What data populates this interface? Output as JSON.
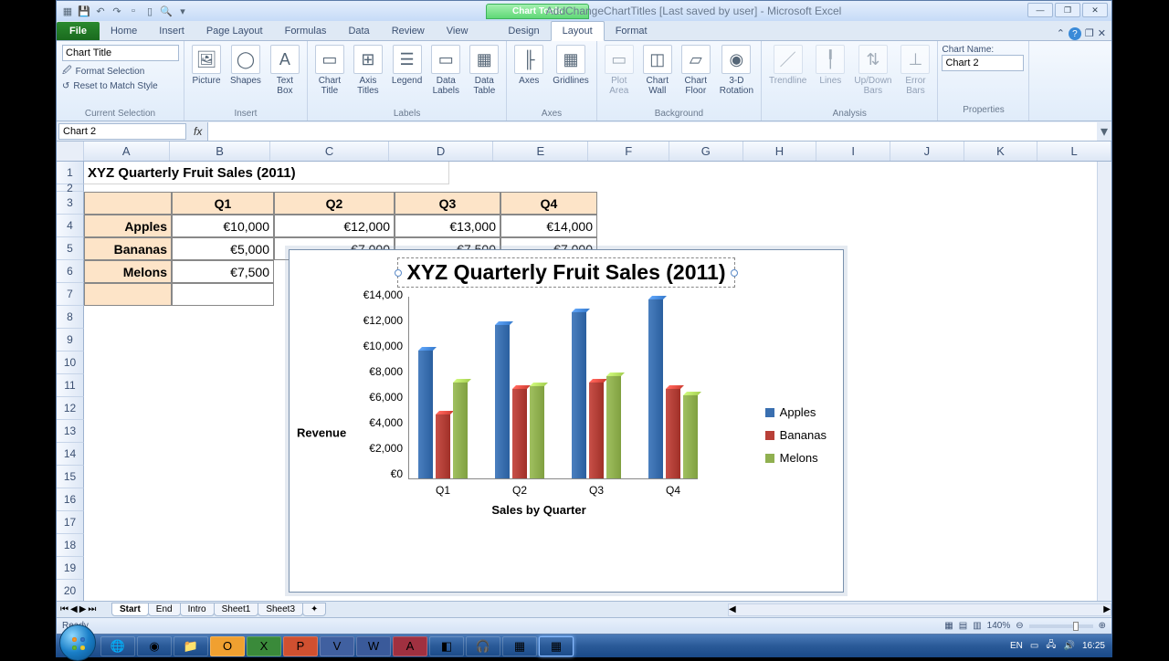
{
  "app": {
    "title": "AddChangeChartTitles [Last saved by user] - Microsoft Excel",
    "chart_tools": "Chart Tools"
  },
  "tabs": {
    "file": "File",
    "items": [
      "Home",
      "Insert",
      "Page Layout",
      "Formulas",
      "Data",
      "Review",
      "View",
      "Design",
      "Layout",
      "Format"
    ],
    "active": "Layout"
  },
  "ribbon": {
    "current_selection": {
      "combo": "Chart Title",
      "format_selection": "Format Selection",
      "reset": "Reset to Match Style",
      "group": "Current Selection"
    },
    "insert": {
      "picture": "Picture",
      "shapes": "Shapes",
      "textbox": "Text\nBox",
      "group": "Insert"
    },
    "labels": {
      "ctitle": "Chart\nTitle",
      "axist": "Axis\nTitles",
      "legend": "Legend",
      "dlabels": "Data\nLabels",
      "dtable": "Data\nTable",
      "group": "Labels"
    },
    "axes": {
      "axes": "Axes",
      "gridlines": "Gridlines",
      "group": "Axes"
    },
    "background": {
      "plotarea": "Plot\nArea",
      "cwall": "Chart\nWall",
      "cfloor": "Chart\nFloor",
      "rot": "3-D\nRotation",
      "group": "Background"
    },
    "analysis": {
      "trend": "Trendline",
      "lines": "Lines",
      "updown": "Up/Down\nBars",
      "error": "Error\nBars",
      "group": "Analysis"
    },
    "properties": {
      "name_label": "Chart Name:",
      "name_value": "Chart 2",
      "group": "Properties"
    }
  },
  "namebox": {
    "value": "Chart 2"
  },
  "sheet": {
    "title": "XYZ Quarterly Fruit Sales (2011)",
    "cols": [
      "A",
      "B",
      "C",
      "D",
      "E",
      "F",
      "G",
      "H",
      "I",
      "J",
      "K",
      "L"
    ],
    "headers": [
      "Q1",
      "Q2",
      "Q3",
      "Q4"
    ],
    "rows": [
      {
        "label": "Apples",
        "vals": [
          "€10,000",
          "€12,000",
          "€13,000",
          "€14,000"
        ]
      },
      {
        "label": "Bananas",
        "vals": [
          "€5,000",
          "€7,000",
          "€7,500",
          "€7,000"
        ]
      },
      {
        "label": "Melons",
        "vals": [
          "€7,500",
          "",
          "",
          ""
        ]
      }
    ]
  },
  "chart_data": {
    "type": "bar",
    "title": "XYZ Quarterly Fruit Sales (2011)",
    "ylabel": "Revenue",
    "xlabel": "Sales by Quarter",
    "categories": [
      "Q1",
      "Q2",
      "Q3",
      "Q4"
    ],
    "series": [
      {
        "name": "Apples",
        "values": [
          10000,
          12000,
          13000,
          14000
        ],
        "color": "#3a6fb0"
      },
      {
        "name": "Bananas",
        "values": [
          5000,
          7000,
          7500,
          7000
        ],
        "color": "#b84038"
      },
      {
        "name": "Melons",
        "values": [
          7500,
          7200,
          8000,
          6500
        ],
        "color": "#90b050"
      }
    ],
    "ylim": [
      0,
      14000
    ],
    "yticks": [
      "€0",
      "€2,000",
      "€4,000",
      "€6,000",
      "€8,000",
      "€10,000",
      "€12,000",
      "€14,000"
    ]
  },
  "sheettabs": {
    "items": [
      "Start",
      "End",
      "Intro",
      "Sheet1",
      "Sheet3"
    ],
    "active": "Start"
  },
  "statusbar": {
    "ready": "Ready",
    "zoom": "140%"
  },
  "taskbar": {
    "lang": "EN",
    "time": "16:25"
  }
}
